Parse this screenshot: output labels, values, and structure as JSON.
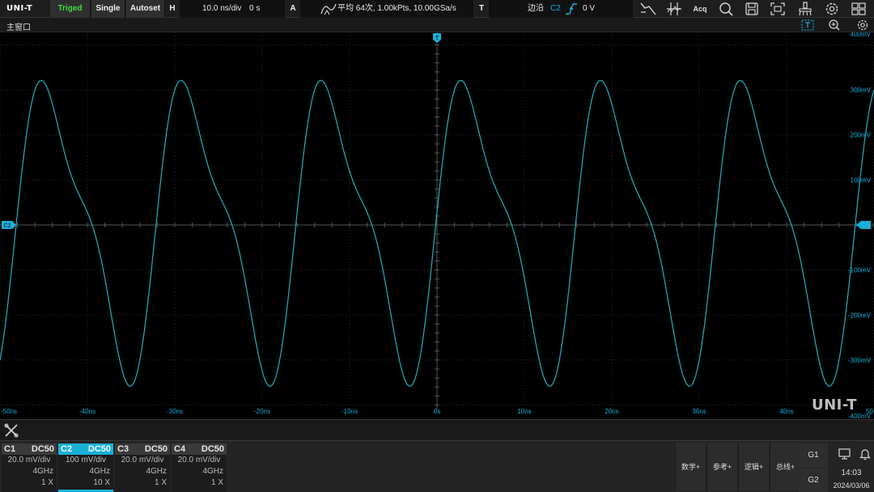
{
  "topbar": {
    "brand": "UNI-T",
    "trigger_status": "Triged",
    "single_label": "Single",
    "autoset_label": "Autoset",
    "h_label": "H",
    "timebase": "10.0 ns/div",
    "time_offset": "0 s",
    "a_label": "A",
    "acquire_info": "平均 64次, 1.00kPts, 10.00GSa/s",
    "t_label": "T",
    "trigger_type": "边沿",
    "trigger_source": "C2",
    "trigger_level": "0 V",
    "status_color": "#3ddc3d",
    "acq_label": "Acq",
    "icons": [
      "cursor-icon",
      "measure-icon",
      "acq-icon",
      "search-icon",
      "save-icon",
      "screenshot-icon",
      "clear-icon",
      "settings-icon",
      "layout-icon"
    ]
  },
  "subbar": {
    "title": "主窗口"
  },
  "screen": {
    "trace_color": "#1fa5b5",
    "y_ticks": [
      "400mV",
      "300mV",
      "200mV",
      "100mV",
      "-100mV",
      "-200mV",
      "-300mV",
      "-400mV"
    ],
    "x_ticks": [
      "-50ns",
      "-40ns",
      "-30ns",
      "-20ns",
      "-10ns",
      "0s",
      "10ns",
      "20ns",
      "30ns",
      "40ns",
      "50"
    ],
    "channel_marker": "C2",
    "trigger_marker": "T",
    "watermark": "UNI-T"
  },
  "chart_data": {
    "type": "line",
    "x_unit": "ns",
    "y_unit": "mV",
    "xlim": [
      -50,
      50
    ],
    "ylim": [
      -400,
      400
    ],
    "series": [
      {
        "period_ns": 16,
        "amplitude_mv": 320,
        "zero_crossing_rising_ns": 0,
        "waveform": "distorted-sine"
      }
    ]
  },
  "channels": [
    {
      "name": "C1",
      "coupling": "DC50",
      "scale": "20.0 mV/div",
      "bandwidth": "4GHz",
      "probe": "1 X",
      "active": false
    },
    {
      "name": "C2",
      "coupling": "DC50",
      "scale": "100 mV/div",
      "bandwidth": "4GHz",
      "probe": "10 X",
      "active": true
    },
    {
      "name": "C3",
      "coupling": "DC50",
      "scale": "20.0 mV/div",
      "bandwidth": "4GHz",
      "probe": "1 X",
      "active": false
    },
    {
      "name": "C4",
      "coupling": "DC50",
      "scale": "20.0 mV/div",
      "bandwidth": "4GHz",
      "probe": "1 X",
      "active": false
    }
  ],
  "menu": {
    "math": "数学+",
    "ref": "参考+",
    "logic": "逻辑+",
    "bus": "总线+",
    "g1": "G1",
    "g2": "G2"
  },
  "clock": {
    "time": "14:03",
    "date": "2024/03/06"
  }
}
